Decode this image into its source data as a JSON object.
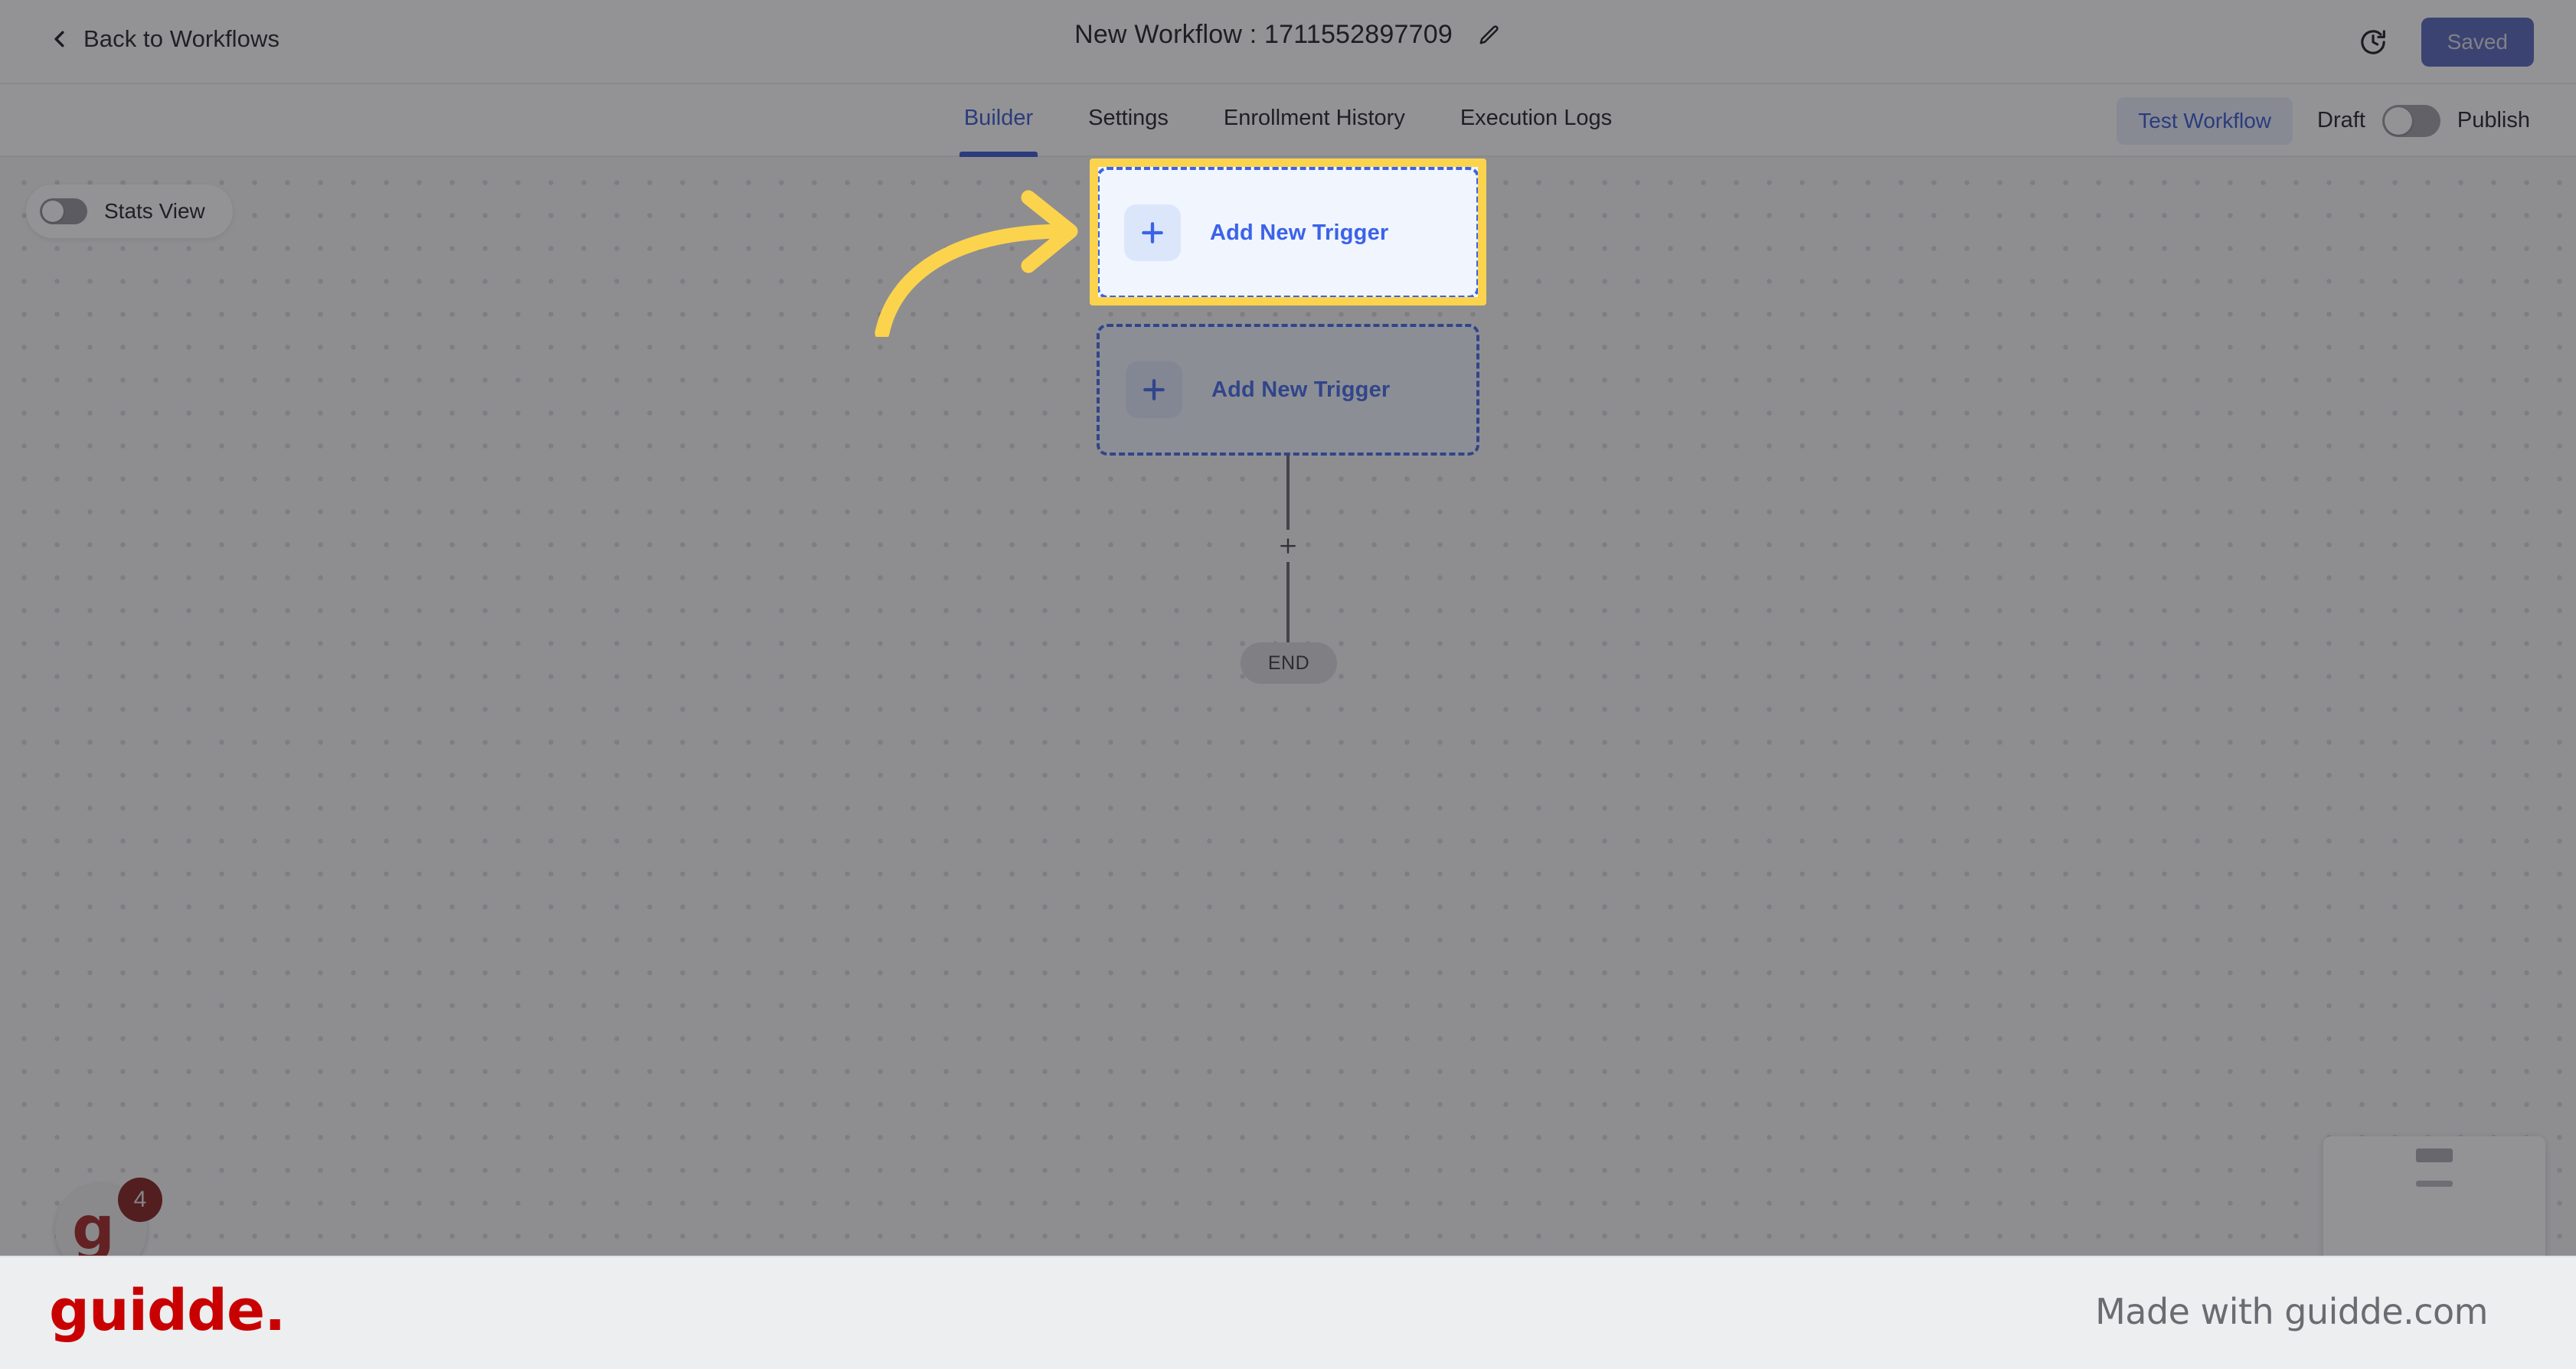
{
  "topbar": {
    "back_label": "Back to Workflows",
    "back_icon": "chevron-left-icon",
    "title": "New Workflow : 1711552897709",
    "edit_icon": "pencil-icon",
    "history_icon": "clock-history-icon",
    "saved_label": "Saved"
  },
  "tabbar": {
    "tabs": [
      {
        "label": "Builder",
        "active": true
      },
      {
        "label": "Settings",
        "active": false
      },
      {
        "label": "Enrollment History",
        "active": false
      },
      {
        "label": "Execution Logs",
        "active": false
      }
    ],
    "test_workflow_label": "Test Workflow",
    "draft_label": "Draft",
    "publish_label": "Publish",
    "publish_toggle_state": "off"
  },
  "canvas": {
    "stats_view_label": "Stats View",
    "stats_view_toggle_state": "off",
    "trigger": {
      "label": "Add New Trigger",
      "plus_icon": "plus-icon"
    },
    "connector_plus_icon": "plus-icon",
    "end_label": "END"
  },
  "widget": {
    "badge_count": "4",
    "logo_letter": "g"
  },
  "footer": {
    "logo": "guidde.",
    "attribution": "Made with guidde.com"
  },
  "colors": {
    "accent_blue": "#3b62e8",
    "tab_active": "#2f4fcd",
    "saved_button": "#3f51b5",
    "highlight_yellow": "#fcd34d",
    "brand_red": "#c80000",
    "canvas_bg": "#f5f5f7",
    "footer_bg": "#edeef0"
  }
}
